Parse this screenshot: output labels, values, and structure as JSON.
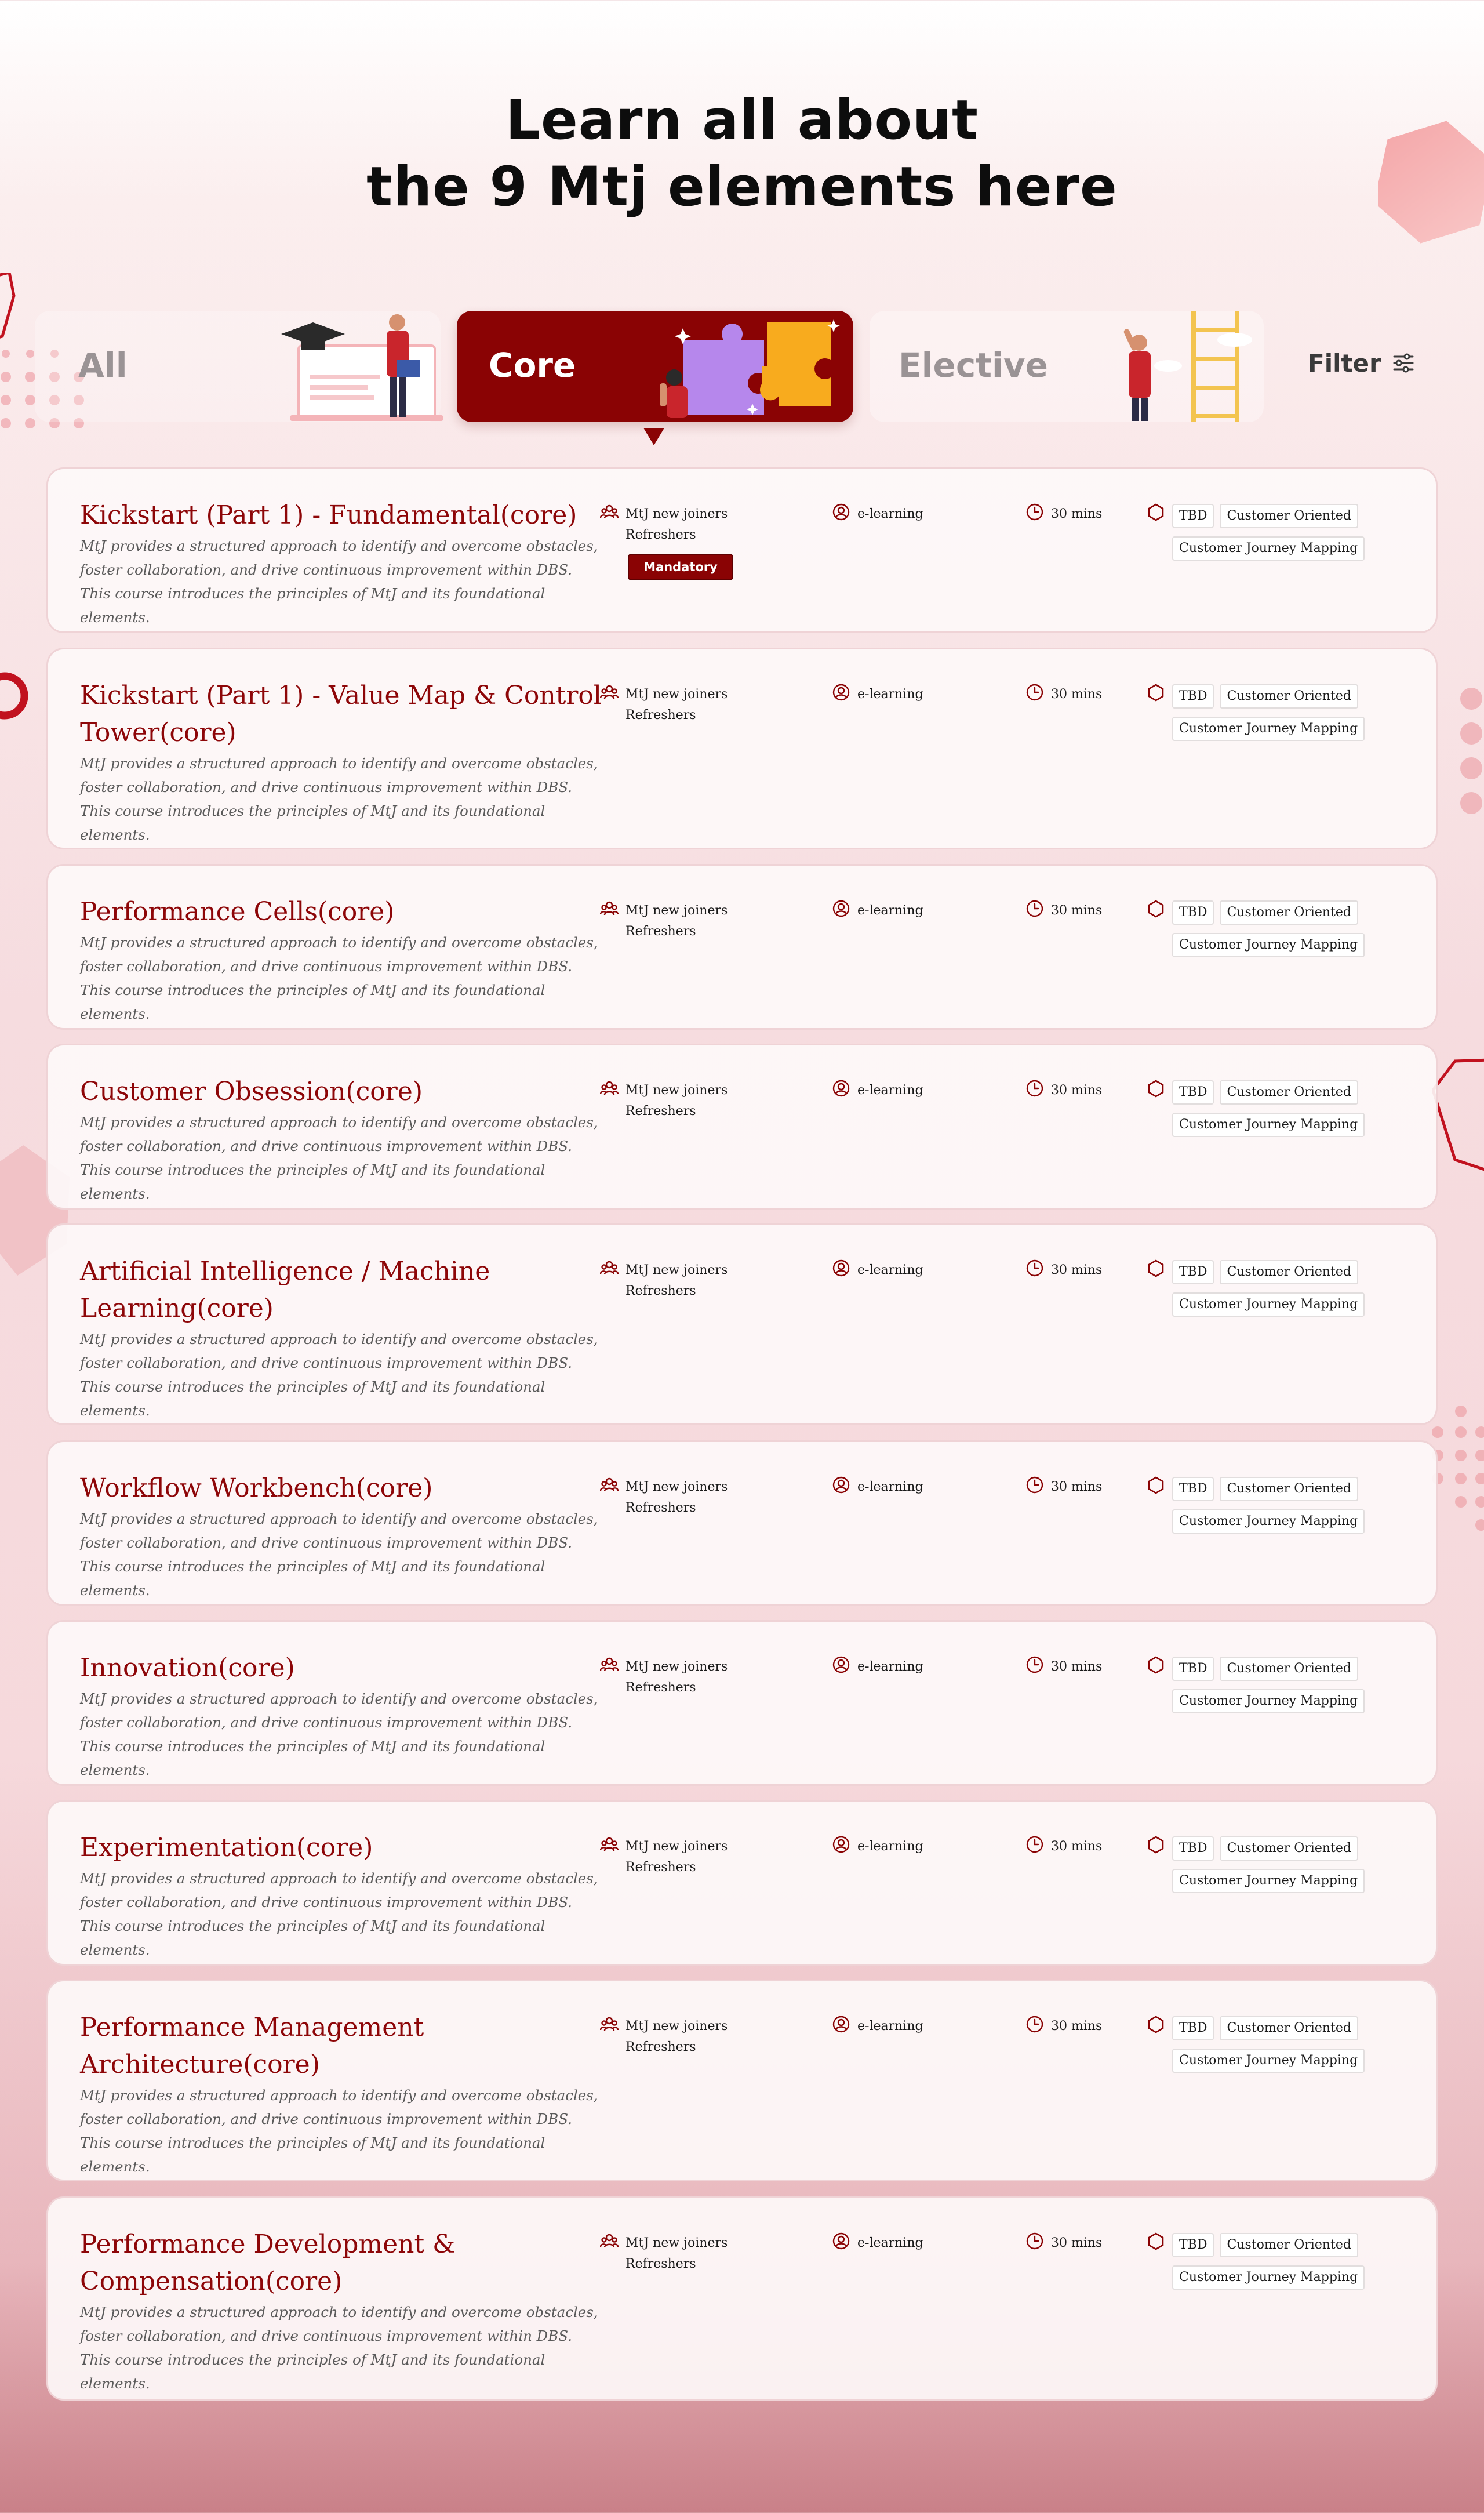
{
  "header": {
    "title_line1": "Learn all about",
    "title_line2": "the 9 Mtj elements here"
  },
  "tabs": {
    "items": [
      {
        "id": "all",
        "label": "All",
        "selected": false
      },
      {
        "id": "core",
        "label": "Core",
        "selected": true
      },
      {
        "id": "elective",
        "label": "Elective",
        "selected": false
      }
    ],
    "filter_label": "Filter"
  },
  "colors": {
    "brand": "#8a0304",
    "title_text": "#8d0608",
    "card_border": "#efd3d6"
  },
  "icons": {
    "audience": "people-group-icon",
    "format": "user-circle-icon",
    "duration": "clock-icon",
    "tags": "hexagon-icon",
    "filter": "sliders-icon"
  },
  "courses": [
    {
      "title": "Kickstart (Part 1) - Fundamental(core)",
      "description": "MtJ provides a structured approach to identify and overcome obstacles, foster collaboration, and drive continuous improvement within DBS. This course introduces the principles of MtJ and its foundational elements.",
      "audience_line1": "MtJ new joiners",
      "audience_line2": "Refreshers",
      "format": "e-learning",
      "duration": "30 mins",
      "tags": [
        "TBD",
        "Customer Oriented",
        "Customer Journey Mapping"
      ],
      "badge": "Mandatory"
    },
    {
      "title": "Kickstart (Part 1) - Value Map & Control Tower(core)",
      "description": "MtJ provides a structured approach to identify and overcome obstacles, foster collaboration, and drive continuous improvement within DBS. This course introduces the principles of MtJ and its foundational elements.",
      "audience_line1": "MtJ new joiners",
      "audience_line2": "Refreshers",
      "format": "e-learning",
      "duration": "30 mins",
      "tags": [
        "TBD",
        "Customer Oriented",
        "Customer Journey Mapping"
      ]
    },
    {
      "title": "Performance Cells(core)",
      "description": "MtJ provides a structured approach to identify and overcome obstacles, foster collaboration, and drive continuous improvement within DBS. This course introduces the principles of MtJ and its foundational elements.",
      "audience_line1": "MtJ new joiners",
      "audience_line2": "Refreshers",
      "format": "e-learning",
      "duration": "30 mins",
      "tags": [
        "TBD",
        "Customer Oriented",
        "Customer Journey Mapping"
      ]
    },
    {
      "title": "Customer Obsession(core)",
      "description": "MtJ provides a structured approach to identify and overcome obstacles, foster collaboration, and drive continuous improvement within DBS. This course introduces the principles of MtJ and its foundational elements.",
      "audience_line1": "MtJ new joiners",
      "audience_line2": "Refreshers",
      "format": "e-learning",
      "duration": "30 mins",
      "tags": [
        "TBD",
        "Customer Oriented",
        "Customer Journey Mapping"
      ]
    },
    {
      "title": "Artificial Intelligence / Machine Learning(core)",
      "description": "MtJ provides a structured approach to identify and overcome obstacles, foster collaboration, and drive continuous improvement within DBS. This course introduces the principles of MtJ and its foundational elements.",
      "audience_line1": "MtJ new joiners",
      "audience_line2": "Refreshers",
      "format": "e-learning",
      "duration": "30 mins",
      "tags": [
        "TBD",
        "Customer Oriented",
        "Customer Journey Mapping"
      ]
    },
    {
      "title": "Workflow Workbench(core)",
      "description": "MtJ provides a structured approach to identify and overcome obstacles, foster collaboration, and drive continuous improvement within DBS. This course introduces the principles of MtJ and its foundational elements.",
      "audience_line1": "MtJ new joiners",
      "audience_line2": "Refreshers",
      "format": "e-learning",
      "duration": "30 mins",
      "tags": [
        "TBD",
        "Customer Oriented",
        "Customer Journey Mapping"
      ]
    },
    {
      "title": "Innovation(core)",
      "description": "MtJ provides a structured approach to identify and overcome obstacles, foster collaboration, and drive continuous improvement within DBS. This course introduces the principles of MtJ and its foundational elements.",
      "audience_line1": "MtJ new joiners",
      "audience_line2": "Refreshers",
      "format": "e-learning",
      "duration": "30 mins",
      "tags": [
        "TBD",
        "Customer Oriented",
        "Customer Journey Mapping"
      ]
    },
    {
      "title": "Experimentation(core)",
      "description": "MtJ provides a structured approach to identify and overcome obstacles, foster collaboration, and drive continuous improvement within DBS. This course introduces the principles of MtJ and its foundational elements.",
      "audience_line1": "MtJ new joiners",
      "audience_line2": "Refreshers",
      "format": "e-learning",
      "duration": "30 mins",
      "tags": [
        "TBD",
        "Customer Oriented",
        "Customer Journey Mapping"
      ]
    },
    {
      "title": "Performance Management Architecture(core)",
      "description": "MtJ provides a structured approach to identify and overcome obstacles, foster collaboration, and drive continuous improvement within DBS. This course introduces the principles of MtJ and its foundational elements.",
      "audience_line1": "MtJ new joiners",
      "audience_line2": "Refreshers",
      "format": "e-learning",
      "duration": "30 mins",
      "tags": [
        "TBD",
        "Customer Oriented",
        "Customer Journey Mapping"
      ]
    },
    {
      "title": "Performance Development & Compensation(core)",
      "description": "MtJ provides a structured approach to identify and overcome obstacles, foster collaboration, and drive continuous improvement within DBS. This course introduces the principles of MtJ and its foundational elements.",
      "audience_line1": "MtJ new joiners",
      "audience_line2": "Refreshers",
      "format": "e-learning",
      "duration": "30 mins",
      "tags": [
        "TBD",
        "Customer Oriented",
        "Customer Journey Mapping"
      ]
    }
  ]
}
